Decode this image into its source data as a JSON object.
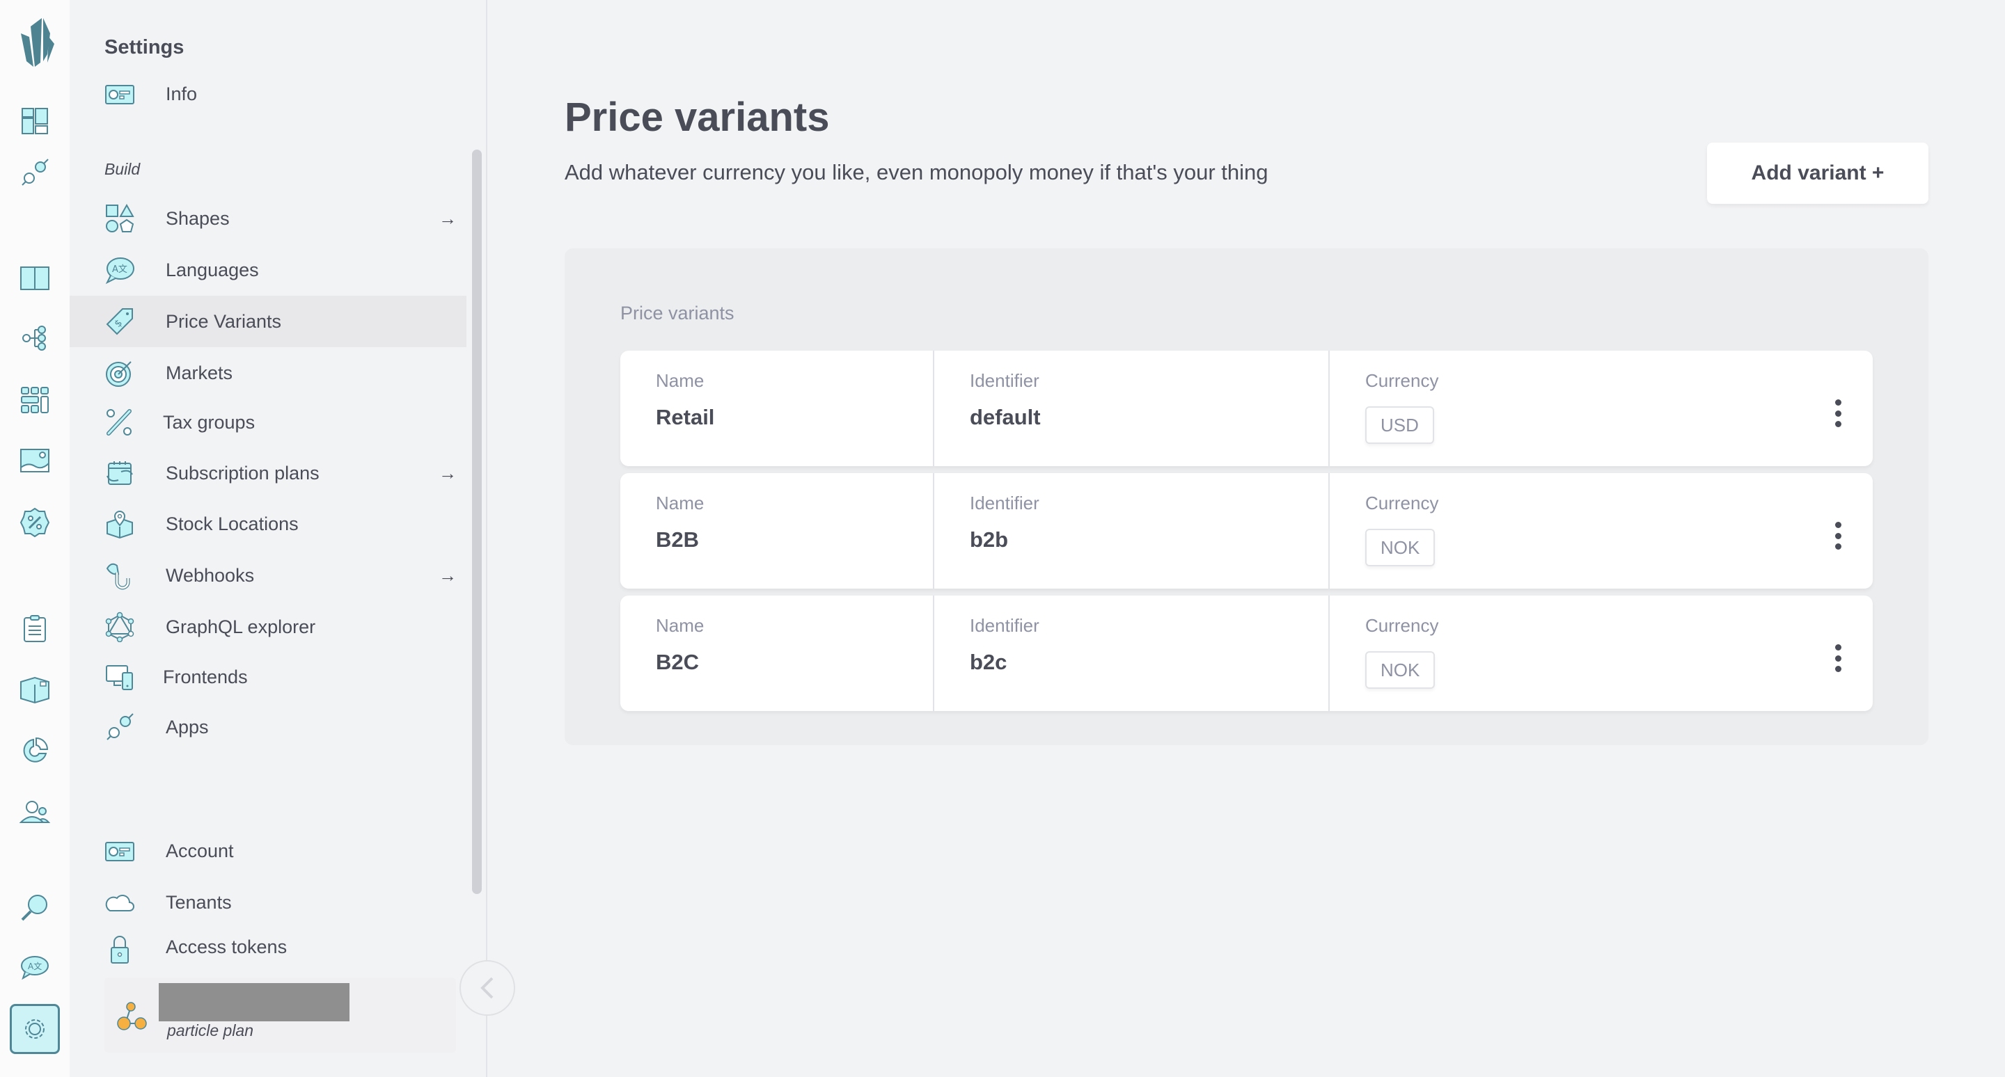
{
  "rail": {
    "items": [
      {
        "icon": "dashboard-icon"
      },
      {
        "icon": "plug-icon"
      },
      {
        "icon": "catalogue-book-icon"
      },
      {
        "icon": "topics-tree-icon"
      },
      {
        "icon": "grids-icon"
      },
      {
        "icon": "image-icon"
      },
      {
        "icon": "discount-badge-icon"
      },
      {
        "icon": "clipboard-icon"
      },
      {
        "icon": "box-icon"
      },
      {
        "icon": "pie-chart-icon"
      },
      {
        "icon": "customers-icon"
      },
      {
        "icon": "search-icon"
      },
      {
        "icon": "translate-icon"
      },
      {
        "icon": "settings-gear-icon",
        "active": true
      }
    ]
  },
  "sidebar": {
    "title": "Settings",
    "info_label": "Info",
    "section_build": "Build",
    "items": [
      {
        "label": "Shapes",
        "icon": "shapes-icon",
        "arrow": true
      },
      {
        "label": "Languages",
        "icon": "translate-icon"
      },
      {
        "label": "Price Variants",
        "icon": "price-tag-icon",
        "active": true
      },
      {
        "label": "Markets",
        "icon": "target-icon"
      },
      {
        "label": "Tax groups",
        "icon": "percent-icon"
      },
      {
        "label": "Subscription plans",
        "icon": "calendar-refresh-icon",
        "arrow": true
      },
      {
        "label": "Stock Locations",
        "icon": "box-location-icon"
      },
      {
        "label": "Webhooks",
        "icon": "hook-icon",
        "arrow": true
      },
      {
        "label": "GraphQL explorer",
        "icon": "graphql-icon"
      },
      {
        "label": "Frontends",
        "icon": "devices-icon"
      },
      {
        "label": "Apps",
        "icon": "plug-icon"
      }
    ],
    "bottom_items": [
      {
        "label": "Account",
        "icon": "id-card-icon"
      },
      {
        "label": "Tenants",
        "icon": "cloud-icon"
      },
      {
        "label": "Access tokens",
        "icon": "lock-icon"
      }
    ],
    "arrow_glyph": "→",
    "plan": "particle plan"
  },
  "main": {
    "title": "Price variants",
    "subtitle": "Add whatever currency you like, even monopoly money if that's your thing",
    "add_button": "Add variant +",
    "panel_label": "Price variants",
    "columns": {
      "name": "Name",
      "identifier": "Identifier",
      "currency": "Currency"
    },
    "rows": [
      {
        "name": "Retail",
        "identifier": "default",
        "currency": "USD"
      },
      {
        "name": "B2B",
        "identifier": "b2b",
        "currency": "NOK"
      },
      {
        "name": "B2C",
        "identifier": "b2c",
        "currency": "NOK"
      }
    ]
  },
  "colors": {
    "icon_fill": "#bff3f6",
    "icon_stroke": "#4f8797",
    "text": "#4a4c57",
    "muted": "#8e92a3",
    "background": "#f2f3f5"
  }
}
